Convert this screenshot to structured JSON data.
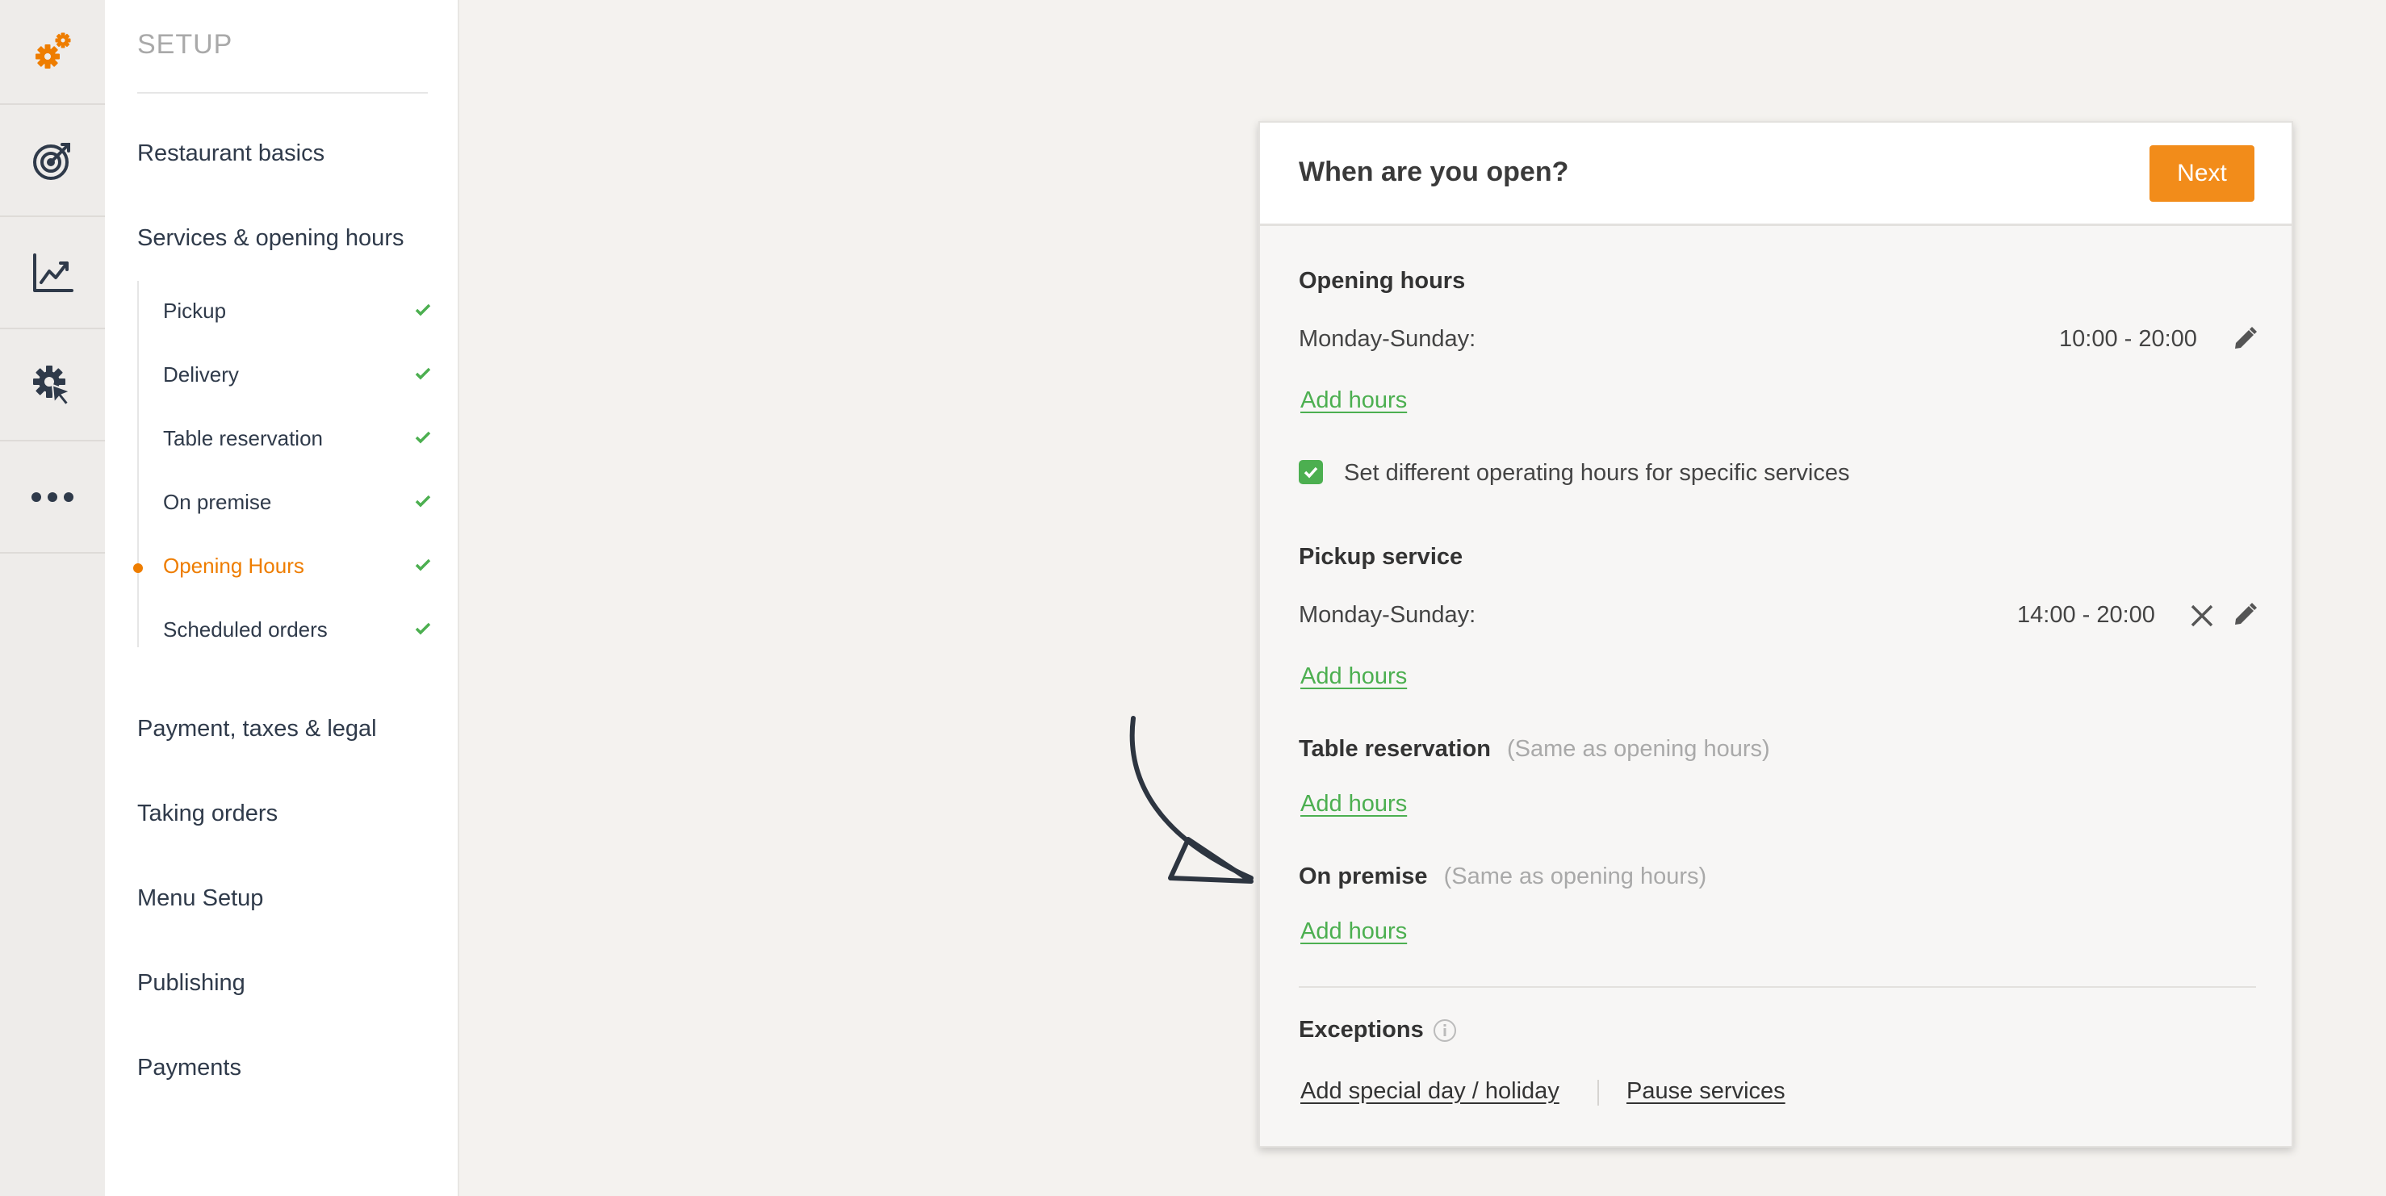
{
  "rail": {
    "icons": [
      "gears-icon",
      "target-icon",
      "chart-icon",
      "gear-cursor-icon",
      "more-icon"
    ]
  },
  "sidebar": {
    "title": "SETUP",
    "sections": [
      {
        "label": "Restaurant basics"
      },
      {
        "label": "Services & opening hours"
      },
      {
        "label": "Payment, taxes & legal"
      },
      {
        "label": "Taking orders"
      },
      {
        "label": "Menu Setup"
      },
      {
        "label": "Publishing"
      },
      {
        "label": "Payments"
      }
    ],
    "subitems": [
      {
        "label": "Pickup",
        "done": true
      },
      {
        "label": "Delivery",
        "done": true
      },
      {
        "label": "Table reservation",
        "done": true
      },
      {
        "label": "On premise",
        "done": true
      },
      {
        "label": "Opening Hours",
        "done": true,
        "active": true
      },
      {
        "label": "Scheduled orders",
        "done": true
      }
    ]
  },
  "card": {
    "title": "When are you open?",
    "next_label": "Next",
    "opening_hours": {
      "heading": "Opening hours",
      "day": "Monday-Sunday:",
      "time": "10:00 - 20:00",
      "add": "Add hours"
    },
    "specific_services": {
      "checked": true,
      "label": "Set different operating hours for specific services"
    },
    "pickup": {
      "heading": "Pickup service",
      "day": "Monday-Sunday:",
      "time": "14:00 - 20:00",
      "add": "Add hours"
    },
    "table_reservation": {
      "heading": "Table reservation",
      "note": "(Same as opening hours)",
      "add": "Add hours"
    },
    "on_premise": {
      "heading": "On premise",
      "note": "(Same as opening hours)",
      "add": "Add hours"
    },
    "exceptions": {
      "heading": "Exceptions",
      "special_day": "Add special day / holiday",
      "pause": "Pause services"
    }
  },
  "colors": {
    "accent": "#ee7d00",
    "button": "#f28c1a",
    "success": "#4caf50"
  }
}
